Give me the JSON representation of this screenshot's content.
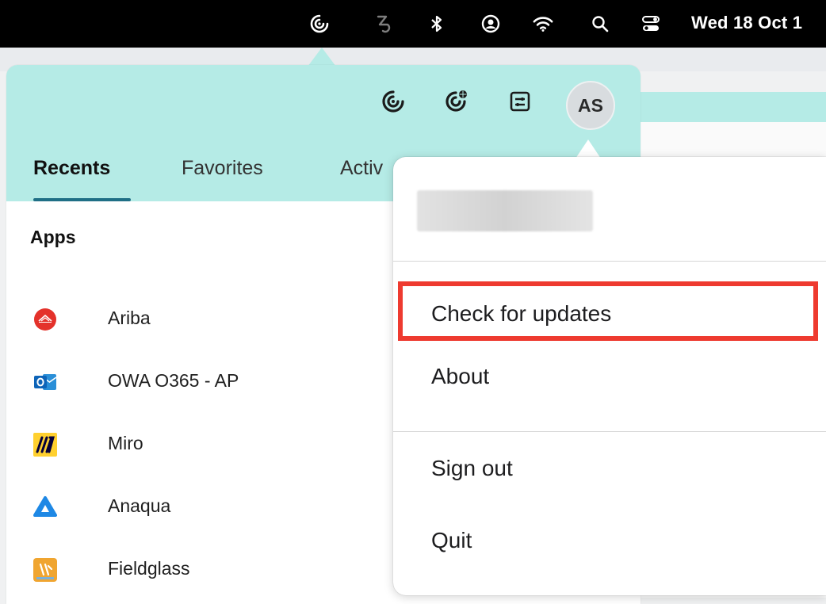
{
  "menubar": {
    "clock": "Wed 18 Oct 1",
    "icons": [
      "citrix-workspace-icon",
      "sync-icon",
      "bluetooth-icon",
      "user-circle-icon",
      "wifi-icon",
      "search-icon",
      "control-center-icon"
    ]
  },
  "header": {
    "icons": [
      "citrix-icon",
      "citrix-globe-icon",
      "settings-sliders-icon"
    ],
    "avatar_initials": "AS"
  },
  "tabs": [
    {
      "label": "Recents",
      "active": true
    },
    {
      "label": "Favorites",
      "active": false
    },
    {
      "label": "Activ",
      "active": false
    }
  ],
  "apps_section": {
    "title": "Apps",
    "items": [
      {
        "label": "Ariba",
        "icon": "ariba-icon"
      },
      {
        "label": "OWA O365 - AP",
        "icon": "outlook-icon"
      },
      {
        "label": "Miro",
        "icon": "miro-icon"
      },
      {
        "label": "Anaqua",
        "icon": "anaqua-icon"
      },
      {
        "label": "Fieldglass",
        "icon": "fieldglass-icon"
      }
    ]
  },
  "menu": {
    "items": [
      {
        "label": "Check for updates",
        "highlighted": true
      },
      {
        "label": "About"
      },
      {
        "label": "Sign out"
      },
      {
        "label": "Quit"
      }
    ],
    "highlight_color": "#ee3a2f"
  },
  "colors": {
    "header_bg": "#b5ebe6",
    "tab_underline": "#1f6f86"
  }
}
